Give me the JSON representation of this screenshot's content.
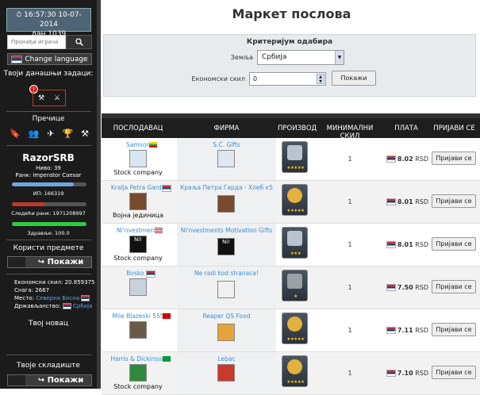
{
  "sidebar": {
    "clock": "16:57:30 10-07-2014",
    "day": "дан 1039",
    "search_placeholder": "Пронађи играча",
    "change_language": "Change language",
    "tasks_title": "Твоји данашњи задаци:",
    "alert_badge": "!",
    "shortcuts_title": "Пречице",
    "username": "RazorSRB",
    "level": "Ниво: 39",
    "rank": "Ранк: Imperator Caesar",
    "xp_label": "ИП:  166319",
    "xp_fraction": 0.83,
    "next_rank_label": "Следећи ранк:  1971208997",
    "next_rank_fraction": 0.45,
    "health_label": "Здравље:  100.0",
    "health_fraction": 1.0,
    "use_items_title": "Користи предмете",
    "show_label": "Покажи",
    "economy_skill": "Економски скил: 20.859375",
    "strength": "Снага: 2667",
    "place_label": "Место:",
    "place_value": "Северна Босна",
    "citizenship_label": "Држављанство:",
    "citizenship_value": "Србија",
    "money_title": "Твој новац",
    "store_title": "Твоје складиште",
    "store_show_label": "Покажи"
  },
  "main": {
    "title": "Маркет послова",
    "criteria_title": "Критеријум одабира",
    "country_label": "Земља",
    "country_value": "Србија",
    "skill_label": "Економски скил",
    "skill_value": "0",
    "show_button": "Покажи"
  },
  "table": {
    "headers": [
      "ПОСЛОДАВАЦ",
      "ФИРМА",
      "ПРОИЗВОД",
      "МИНИМАЛНИ СКИЛ",
      "ПЛАТА",
      "ПРИЈАВИ СЕ"
    ],
    "rows": [
      {
        "employer": "Samson",
        "employer_type": "Stock company",
        "company": "S.C. Gifts",
        "product": "gift-box",
        "quality": 5,
        "min_skill": "1",
        "salary": "8.02",
        "currency": "RSD",
        "apply": "Пријави се"
      },
      {
        "employer": "Kralja Petra Garda",
        "employer_type": "Војна јединица",
        "company": "Краља Петра Гарда - Хлеб к5",
        "product": "bread",
        "quality": 5,
        "min_skill": "1",
        "salary": "8.01",
        "currency": "RSD",
        "apply": "Пријави се"
      },
      {
        "employer": "Ni'nvestments",
        "employer_type": "Stock company",
        "company": "Ni'nvestments Motivation Gifts",
        "product": "gift-box",
        "quality": 3,
        "min_skill": "1",
        "salary": "8.01",
        "currency": "RSD",
        "apply": "Пријави се"
      },
      {
        "employer": "Bosko E",
        "employer_type": "",
        "company": "Ne radi kod stranaca!",
        "product": "pistol",
        "quality": 1,
        "min_skill": "1",
        "salary": "7.50",
        "currency": "RSD",
        "apply": "Пријави се"
      },
      {
        "employer": "Mile Blazeski 555",
        "employer_type": "",
        "company": "Reaper QS Food",
        "product": "bread",
        "quality": 5,
        "min_skill": "1",
        "salary": "7.11",
        "currency": "RSD",
        "apply": "Пријави се"
      },
      {
        "employer": "Harris & Dickinson",
        "employer_type": "Stock company",
        "company": "Lebac",
        "product": "bread",
        "quality": 5,
        "min_skill": "1",
        "salary": "7.10",
        "currency": "RSD",
        "apply": "Пријави се"
      }
    ]
  },
  "colors": {
    "accent": "#3a8fd6",
    "xp_bar": "#6fa8dc",
    "rank_bar": "#c0392b",
    "health_bar": "#2ecc40",
    "star": "#f5c518"
  }
}
